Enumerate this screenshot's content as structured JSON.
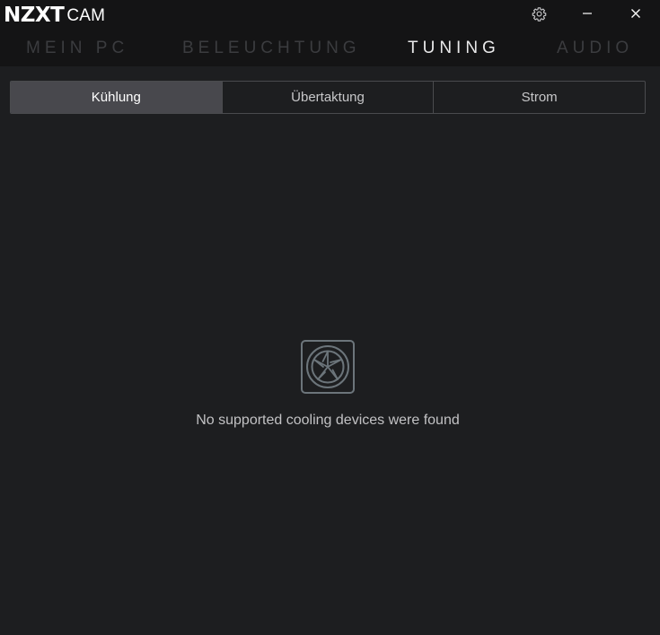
{
  "app": {
    "brand": "NZXT",
    "product": "CAM"
  },
  "window": {
    "settings_icon": "gear-icon",
    "minimize_icon": "minimize-icon",
    "close_icon": "close-icon"
  },
  "nav": {
    "items": [
      {
        "label": "MEIN PC",
        "active": false
      },
      {
        "label": "BELEUCHTUNG",
        "active": false
      },
      {
        "label": "TUNING",
        "active": true
      },
      {
        "label": "AUDIO",
        "active": false
      }
    ]
  },
  "subtabs": {
    "items": [
      {
        "label": "Kühlung",
        "active": true
      },
      {
        "label": "Übertaktung",
        "active": false
      },
      {
        "label": "Strom",
        "active": false
      }
    ]
  },
  "empty_state": {
    "icon": "fan-icon",
    "message": "No supported cooling devices were found"
  },
  "colors": {
    "background": "#1d1e20",
    "titlebar": "#141415",
    "nav_inactive": "#3b3c3f",
    "nav_active": "#e9e9ea",
    "tab_active_bg": "#48484d",
    "icon_stroke": "#6c757b"
  }
}
